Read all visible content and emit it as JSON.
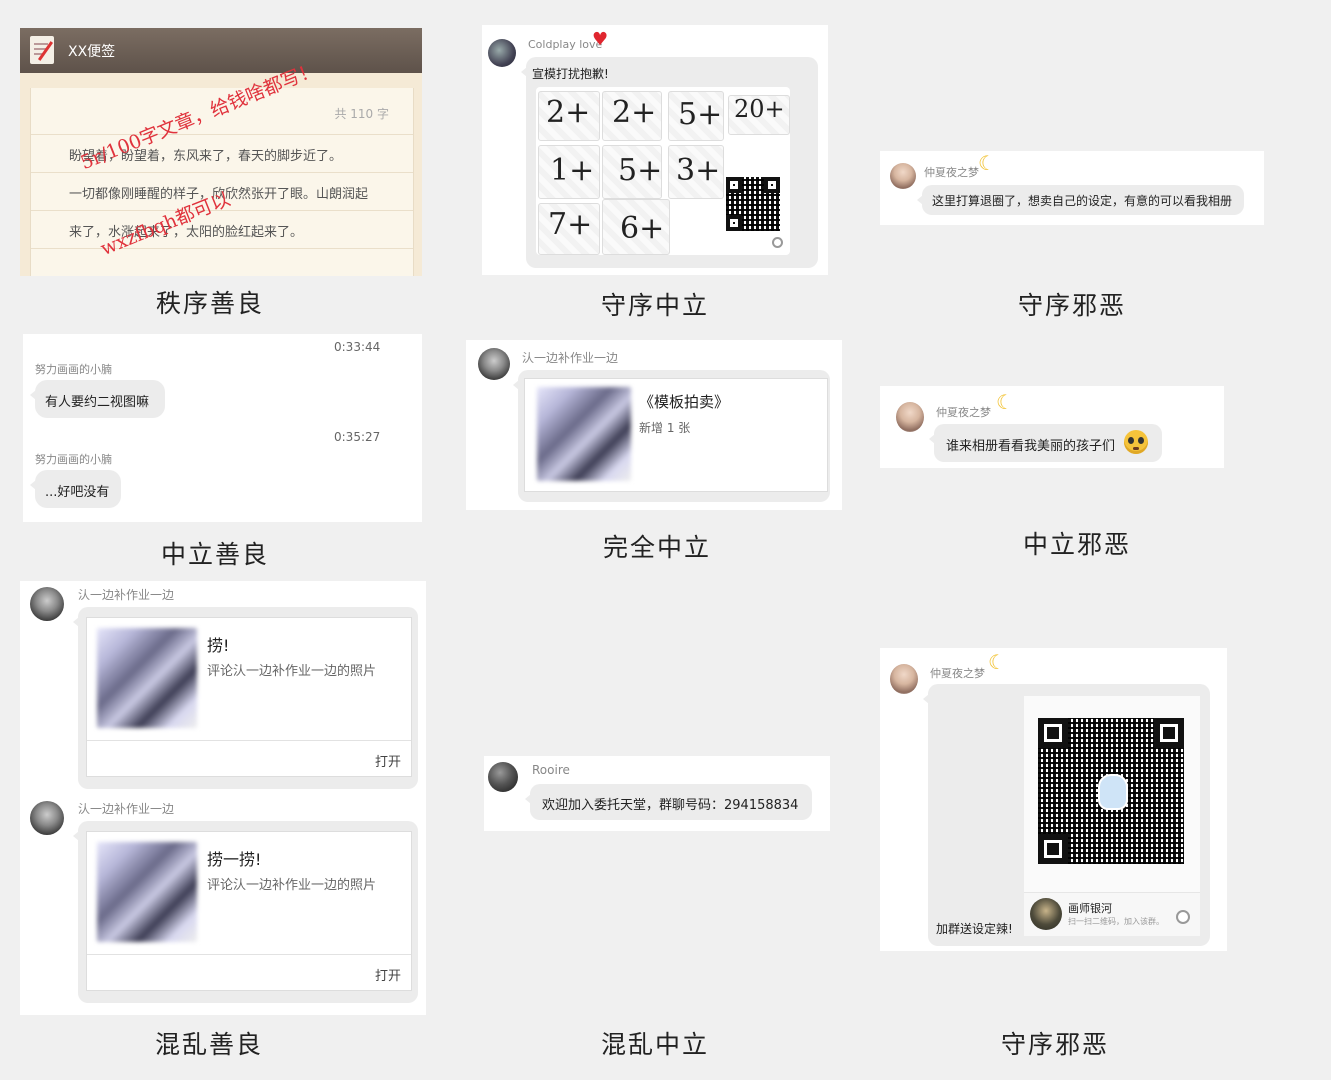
{
  "captions": {
    "c1": "秩序善良",
    "c2": "守序中立",
    "c3": "守序邪恶",
    "c4": "中立善良",
    "c5": "完全中立",
    "c6": "中立邪恶",
    "c7": "混乱善良",
    "c8": "混乱中立",
    "c9": "守序邪恶"
  },
  "memo": {
    "app_title": "XX便签",
    "word_count": "共 110 字",
    "lines": [
      "盼望着，盼望着，东风来了，春天的脚步近了。",
      "一切都像刚睡醒的样子，欣欣然张开了眼。山朗润起",
      "来了，水涨起来了，太阳的脸红起来了。"
    ],
    "overlay_1": "5r/100字文章，给钱啥都写！",
    "overlay_2": "wxzfbqh都可以"
  },
  "p2": {
    "name": "Coldplay love",
    "message": "宣模打扰抱歉!",
    "prices": [
      "2+",
      "2+",
      "5+",
      "20+",
      "1+",
      "5+",
      "3+",
      "7+",
      "6+"
    ]
  },
  "p3": {
    "name": "仲夏夜之梦",
    "message": "这里打算退圈了，想卖自己的设定，有意的可以看我相册"
  },
  "p4": {
    "time1": "0:33:44",
    "name1": "努力画画的小腩",
    "msg1": "有人要约二视图嘛",
    "time2": "0:35:27",
    "name2": "努力画画的小腩",
    "msg2": "...好吧没有"
  },
  "p5": {
    "name": "汄一边补作业一边",
    "card_title": "《模板拍卖》",
    "card_sub": "新增 1 张"
  },
  "p6": {
    "name": "仲夏夜之梦",
    "message": "谁来相册看看我美丽的孩子们"
  },
  "p7": {
    "items": [
      {
        "name": "汄一边补作业一边",
        "title": "捞!",
        "desc": "评论汄一边补作业一边的照片",
        "open": "打开"
      },
      {
        "name": "汄一边补作业一边",
        "title": "捞一捞!",
        "desc": "评论汄一边补作业一边的照片",
        "open": "打开"
      }
    ]
  },
  "p8": {
    "name": "Rooire",
    "message": "欢迎加入委托天堂，群聊号码：294158834"
  },
  "p9": {
    "name": "仲夏夜之梦",
    "message": "加群送设定辣!",
    "group_name": "画师银河",
    "group_hint": "扫一扫二维码，加入该群。"
  }
}
